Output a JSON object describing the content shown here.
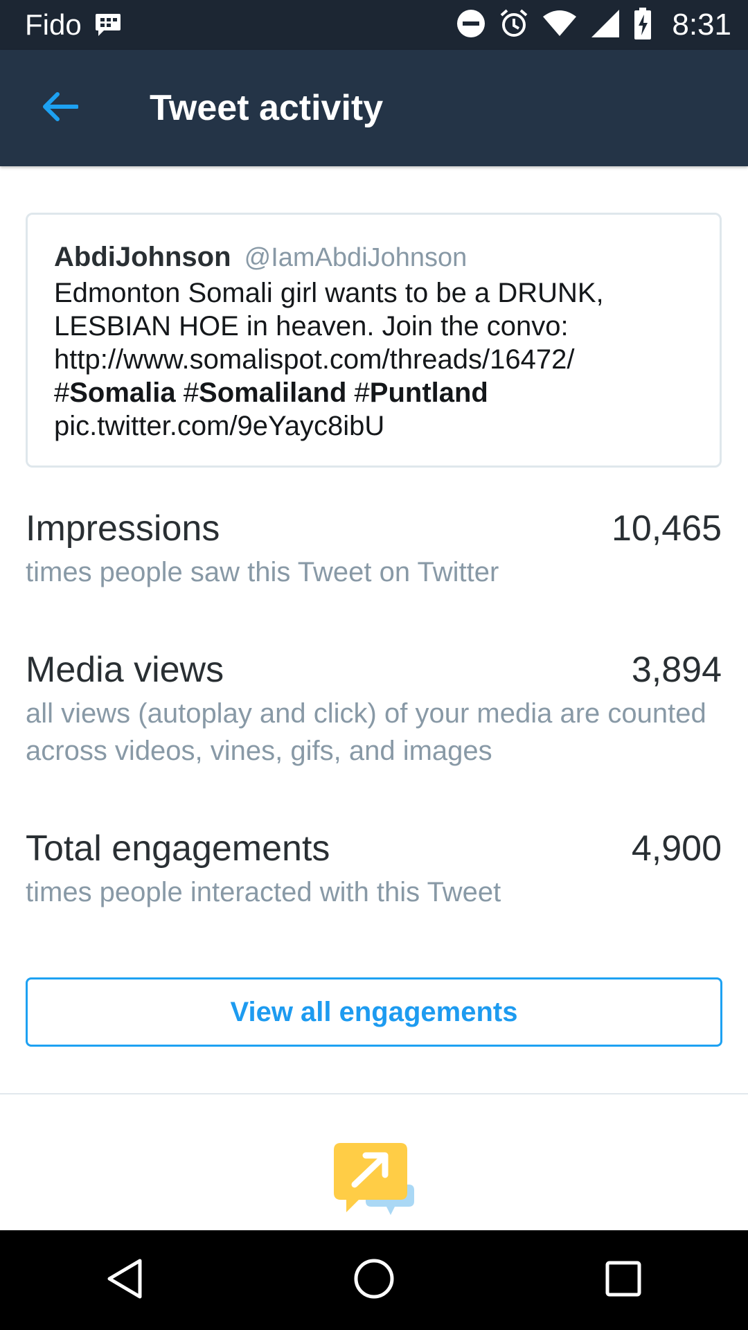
{
  "status_bar": {
    "carrier": "Fido",
    "time": "8:31",
    "icons": [
      "bbm-icon",
      "do-not-disturb-icon",
      "alarm-icon",
      "wifi-icon",
      "cell-signal-icon",
      "battery-charging-icon"
    ]
  },
  "toolbar": {
    "title": "Tweet activity",
    "back_icon": "arrow-back-icon"
  },
  "tweet": {
    "author": "AbdiJohnson",
    "handle": "@IamAbdiJohnson",
    "text_line1": "Edmonton Somali girl wants to be a DRUNK,",
    "text_line2": "LESBIAN HOE in heaven. Join the convo:",
    "text_line3": "http://www.somalispot.com/threads/16472/",
    "hashtags": [
      "#Somalia",
      "#Somaliland",
      "#Puntland"
    ],
    "pic_link": "pic.twitter.com/9eYayc8ibU"
  },
  "metrics": [
    {
      "title": "Impressions",
      "value": "10,465",
      "description": "times people saw this Tweet on Twitter"
    },
    {
      "title": "Media views",
      "value": "3,894",
      "description": "all views (autoplay and click) of your media are counted across videos, vines, gifs, and images"
    },
    {
      "title": "Total engagements",
      "value": "4,900",
      "description": "times people interacted with this Tweet"
    }
  ],
  "actions": {
    "view_all": "View all engagements"
  },
  "colors": {
    "status_bar": "#1c2633",
    "toolbar": "#243447",
    "accent": "#1da1f2",
    "muted_text": "#8899a6",
    "promo_yellow": "#ffcd46",
    "promo_blue": "#aad8f5"
  },
  "nav": {
    "icons": [
      "back-triangle-icon",
      "home-circle-icon",
      "recents-square-icon"
    ]
  }
}
